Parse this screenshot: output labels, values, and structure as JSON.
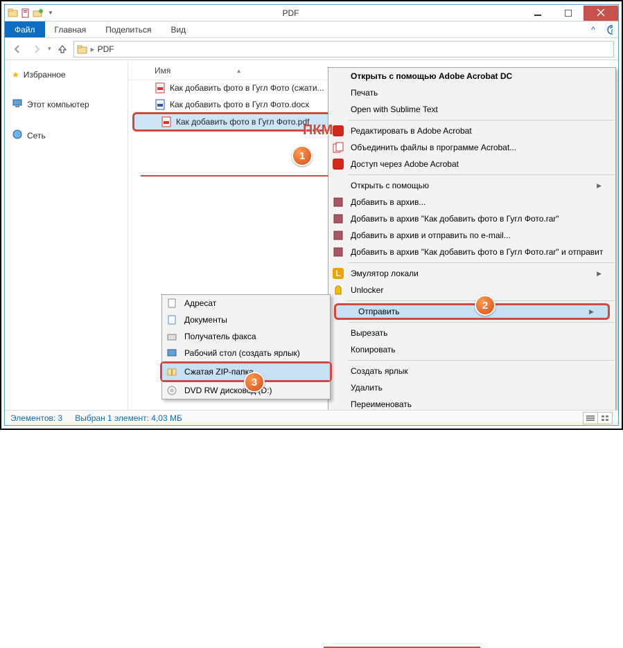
{
  "window_title": "PDF",
  "menubar": {
    "file": "Файл",
    "home": "Главная",
    "share": "Поделиться",
    "view": "Вид"
  },
  "breadcrumb": {
    "label": "PDF"
  },
  "sidebar": {
    "favorites": "Избранное",
    "computer": "Этот компьютер",
    "network": "Сеть"
  },
  "columns": {
    "name_header": "Имя"
  },
  "files": [
    {
      "name": "Как добавить фото в Гугл Фото (сжати..."
    },
    {
      "name": "Как добавить фото в Гугл Фото.docx"
    },
    {
      "name": "Как добавить фото в Гугл Фото.pdf"
    }
  ],
  "statusbar": {
    "items": "Элементов: 3",
    "selection": "Выбран 1 элемент: 4,03 МБ"
  },
  "annotation": {
    "pkm": "ПКМ",
    "b1": "1",
    "b2": "2",
    "b3": "3"
  },
  "context_menu": {
    "open_with_acrobat_dc": "Открыть с помощью Adobe Acrobat DC",
    "print": "Печать",
    "open_sublime": "Open with Sublime Text",
    "edit_acrobat": "Редактировать в Adobe Acrobat",
    "combine_files": "Объединить файлы в программе Acrobat...",
    "access_acrobat": "Доступ через Adobe Acrobat",
    "open_with": "Открыть с помощью",
    "add_archive": "Добавить в архив...",
    "add_archive_rar": "Добавить в архив \"Как добавить фото в Гугл Фото.rar\"",
    "archive_email": "Добавить в архив и отправить по e-mail...",
    "archive_rar_email": "Добавить в архив \"Как добавить фото в Гугл Фото.rar\" и отправит",
    "emulator": "Эмулятор локали",
    "unlocker": "Unlocker",
    "send_to": "Отправить",
    "cut": "Вырезать",
    "copy": "Копировать",
    "create_shortcut": "Создать ярлык",
    "delete": "Удалить",
    "rename": "Переименовать"
  },
  "send_to_menu": {
    "bluetooth": "Адресат",
    "documents": "Документы",
    "fax": "Получатель факса",
    "desktop_shortcut": "Рабочий стол (создать ярлык)",
    "zip": "Сжатая ZIP-папка",
    "dvd": "DVD RW дисковод (D:)"
  }
}
